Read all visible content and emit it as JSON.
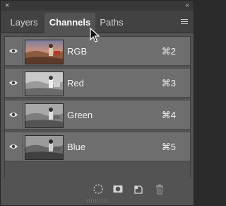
{
  "window": {
    "close_glyph": "×",
    "collapse_glyph": "‹‹"
  },
  "tabs": [
    {
      "label": "Layers",
      "active": false
    },
    {
      "label": "Channels",
      "active": true
    },
    {
      "label": "Paths",
      "active": false
    }
  ],
  "channels": [
    {
      "name": "RGB",
      "shortcut": "⌘2",
      "visible": true,
      "thumbnail": "color"
    },
    {
      "name": "Red",
      "shortcut": "⌘3",
      "visible": true,
      "thumbnail": "grayscale-bright"
    },
    {
      "name": "Green",
      "shortcut": "⌘4",
      "visible": true,
      "thumbnail": "grayscale-mid"
    },
    {
      "name": "Blue",
      "shortcut": "⌘5",
      "visible": true,
      "thumbnail": "grayscale-dark"
    }
  ],
  "bottom_toolbar": {
    "icons": [
      "load-selection-icon",
      "save-selection-icon",
      "new-channel-icon",
      "delete-channel-icon"
    ]
  },
  "colors": {
    "panel": "#535353",
    "row": "#6e6e6e",
    "tab_bar": "#424242"
  }
}
